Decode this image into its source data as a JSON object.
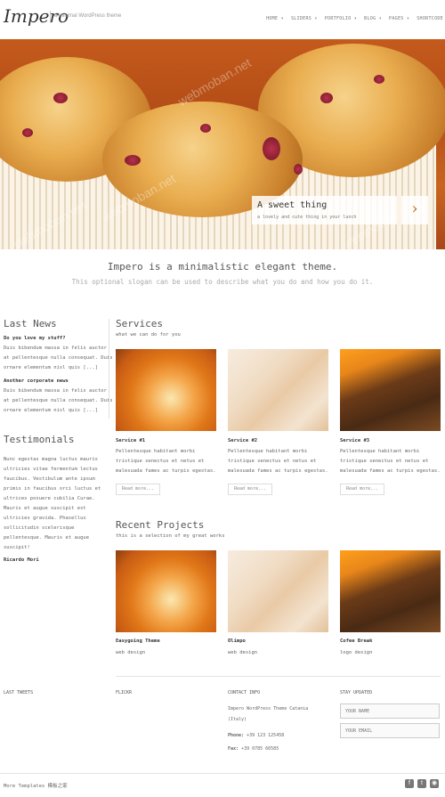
{
  "header": {
    "logo": "Impero",
    "tagline": "a minimal WordPress theme",
    "nav": [
      "HOME ▾",
      "SLIDERS ▾",
      "PORTFOLIO ▾",
      "BLOG ▾",
      "PAGES ▾",
      "SHORTCODE"
    ]
  },
  "hero": {
    "title": "A sweet thing",
    "subtitle": "a lovely and cute thing in your lunch",
    "next_icon": "chevron-right-icon",
    "watermark": "webmoban.net"
  },
  "intro": {
    "title": "Impero is a minimalistic elegant theme.",
    "slogan": "This optional slogan can be used to describe what you do and how you do it."
  },
  "news": {
    "heading": "Last News",
    "items": [
      {
        "title": "Do you love my stuff?",
        "lines": [
          "Duis bibendum massa in felis auctor",
          "at pellentesque nulla consequat. Duis",
          "ornare elementum nisl quis [...]"
        ]
      },
      {
        "title": "Another corporate news",
        "lines": [
          "Duis bibendum massa in felis auctor",
          "at pellentesque nulla consequat. Duis",
          "ornare elementum nisl quis [...]"
        ]
      }
    ]
  },
  "testimonials": {
    "heading": "Testimonials",
    "lines": [
      "Nunc egestas magna luctus mauris",
      "ultricies vitae fermentum lectus",
      "faucibus. Vestibulum ante ipsum",
      "primis in faucibus orci luctus et",
      "ultrices posuere cubilia Curae.",
      "Mauris et augue suscipit est",
      "ultricies gravida. Phasellus",
      "sollicitudin scelerisque",
      "pellentesque. Mauris et augue",
      "suscipit!"
    ],
    "author": "Ricardo Mori"
  },
  "services": {
    "heading": "Services",
    "subheading": "what we can do for you",
    "items": [
      {
        "title": "Service #1",
        "lines": [
          "Pellentesque habitant morbi",
          "tristique senectus et netus et",
          "malesuada fames ac turpis egestas."
        ],
        "button": "Read more..."
      },
      {
        "title": "Service #2",
        "lines": [
          "Pellentesque habitant morbi",
          "tristique senectus et netus et",
          "malesuada fames ac turpis egestas."
        ],
        "button": "Read more..."
      },
      {
        "title": "Service #3",
        "lines": [
          "Pellentesque habitant morbi",
          "tristique senectus et netus et",
          "malesuada fames ac turpis egestas."
        ],
        "button": "Read more..."
      }
    ]
  },
  "projects": {
    "heading": "Recent Projects",
    "subheading": "this is a selection of my great works",
    "items": [
      {
        "title": "Easygoing Theme",
        "category": "web design"
      },
      {
        "title": "Olimpo",
        "category": "web design"
      },
      {
        "title": "Cofee Break",
        "category": "logo design"
      }
    ]
  },
  "footer": {
    "tweets_heading": "LAST TWEETS",
    "flickr_heading": "FLICKR",
    "contact_heading": "CONTACT INFO",
    "contact_lines": [
      "Impero WordPress Theme Catania",
      "(Italy)"
    ],
    "phone_label": "Phone:",
    "phone": "+39 123 125458",
    "fax_label": "Fax:",
    "fax": "+39 0785 66585",
    "updated_heading": "STAY UPDATED",
    "name_placeholder": "YOUR NAME",
    "email_placeholder": "YOUR EMAIL",
    "bottom_text": "More Templates 模板之家",
    "social": [
      "facebook-icon",
      "twitter-icon",
      "rss-icon"
    ]
  }
}
